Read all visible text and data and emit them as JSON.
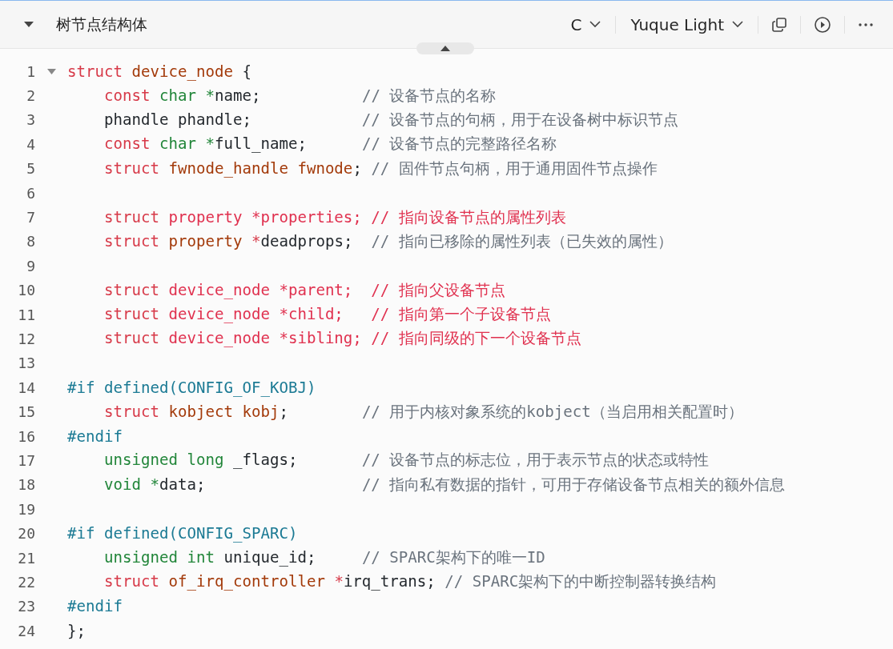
{
  "block": {
    "title": "树节点结构体",
    "language": "C",
    "theme": "Yuque Light"
  },
  "lines": [
    {
      "number": "1",
      "fold": true,
      "tokens": [
        {
          "kind": "keyword",
          "text": "struct "
        },
        {
          "kind": "ident",
          "text": "device_node"
        },
        {
          "kind": "plain",
          "text": " {"
        }
      ]
    },
    {
      "number": "2",
      "tokens": [
        {
          "kind": "keyword",
          "text": "    const "
        },
        {
          "kind": "type",
          "text": "char *"
        },
        {
          "kind": "plain",
          "text": "name;           "
        },
        {
          "kind": "comment",
          "text": "// 设备节点的名称"
        }
      ]
    },
    {
      "number": "3",
      "tokens": [
        {
          "kind": "plain",
          "text": "    phandle phandle;            "
        },
        {
          "kind": "comment",
          "text": "// 设备节点的句柄，用于在设备树中标识节点"
        }
      ]
    },
    {
      "number": "4",
      "tokens": [
        {
          "kind": "keyword",
          "text": "    const "
        },
        {
          "kind": "type",
          "text": "char *"
        },
        {
          "kind": "plain",
          "text": "full_name;      "
        },
        {
          "kind": "comment",
          "text": "// 设备节点的完整路径名称"
        }
      ]
    },
    {
      "number": "5",
      "tokens": [
        {
          "kind": "keyword",
          "text": "    struct "
        },
        {
          "kind": "ident",
          "text": "fwnode_handle fwnode"
        },
        {
          "kind": "plain",
          "text": "; "
        },
        {
          "kind": "comment",
          "text": "// 固件节点句柄，用于通用固件节点操作"
        }
      ]
    },
    {
      "number": "6"
    },
    {
      "number": "7",
      "tokens": [
        {
          "kind": "keyword",
          "text": "    struct "
        },
        {
          "kind": "invalid",
          "text": "property *properties; // 指向设备节点的属性列表"
        }
      ]
    },
    {
      "number": "8",
      "tokens": [
        {
          "kind": "keyword",
          "text": "    struct "
        },
        {
          "kind": "ident",
          "text": "property "
        },
        {
          "kind": "keyword",
          "text": "*"
        },
        {
          "kind": "plain",
          "text": "deadprops;  "
        },
        {
          "kind": "comment",
          "text": "// 指向已移除的属性列表（已失效的属性）"
        }
      ]
    },
    {
      "number": "9"
    },
    {
      "number": "10",
      "tokens": [
        {
          "kind": "keyword",
          "text": "    struct "
        },
        {
          "kind": "invalid",
          "text": "device_node *parent;  // 指向父设备节点"
        }
      ]
    },
    {
      "number": "11",
      "tokens": [
        {
          "kind": "keyword",
          "text": "    struct "
        },
        {
          "kind": "invalid",
          "text": "device_node *child;   // 指向第一个子设备节点"
        }
      ]
    },
    {
      "number": "12",
      "tokens": [
        {
          "kind": "keyword",
          "text": "    struct "
        },
        {
          "kind": "invalid",
          "text": "device_node *sibling; // 指向同级的下一个设备节点"
        }
      ]
    },
    {
      "number": "13"
    },
    {
      "number": "14",
      "tokens": [
        {
          "kind": "preproc",
          "text": "#if defined(CONFIG_OF_KOBJ)"
        }
      ]
    },
    {
      "number": "15",
      "tokens": [
        {
          "kind": "keyword",
          "text": "    struct "
        },
        {
          "kind": "ident",
          "text": "kobject kobj"
        },
        {
          "kind": "plain",
          "text": ";        "
        },
        {
          "kind": "comment",
          "text": "// 用于内核对象系统的kobject（当启用相关配置时）"
        }
      ]
    },
    {
      "number": "16",
      "tokens": [
        {
          "kind": "preproc",
          "text": "#endif"
        }
      ]
    },
    {
      "number": "17",
      "tokens": [
        {
          "kind": "type",
          "text": "    unsigned long "
        },
        {
          "kind": "plain",
          "text": "_flags;       "
        },
        {
          "kind": "comment",
          "text": "// 设备节点的标志位，用于表示节点的状态或特性"
        }
      ]
    },
    {
      "number": "18",
      "tokens": [
        {
          "kind": "type",
          "text": "    void *"
        },
        {
          "kind": "plain",
          "text": "data;                 "
        },
        {
          "kind": "comment",
          "text": "// 指向私有数据的指针，可用于存储设备节点相关的额外信息"
        }
      ]
    },
    {
      "number": "19"
    },
    {
      "number": "20",
      "tokens": [
        {
          "kind": "preproc",
          "text": "#if defined(CONFIG_SPARC)"
        }
      ]
    },
    {
      "number": "21",
      "tokens": [
        {
          "kind": "type",
          "text": "    unsigned int "
        },
        {
          "kind": "plain",
          "text": "unique_id;     "
        },
        {
          "kind": "comment",
          "text": "// SPARC架构下的唯一ID"
        }
      ]
    },
    {
      "number": "22",
      "tokens": [
        {
          "kind": "keyword",
          "text": "    struct "
        },
        {
          "kind": "ident",
          "text": "of_irq_controller "
        },
        {
          "kind": "keyword",
          "text": "*"
        },
        {
          "kind": "plain",
          "text": "irq_trans; "
        },
        {
          "kind": "comment",
          "text": "// SPARC架构下的中断控制器转换结构"
        }
      ]
    },
    {
      "number": "23",
      "tokens": [
        {
          "kind": "preproc",
          "text": "#endif"
        }
      ]
    },
    {
      "number": "24",
      "tokens": [
        {
          "kind": "plain",
          "text": "};"
        }
      ]
    }
  ]
}
